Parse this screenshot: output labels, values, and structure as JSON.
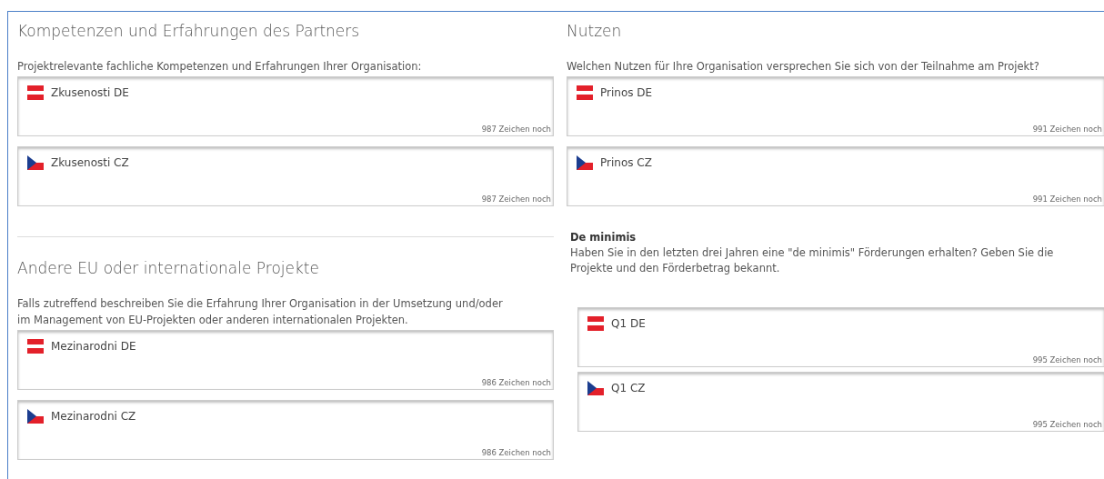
{
  "columns": [
    {
      "sections": [
        {
          "kind": "section",
          "title": "Kompetenzen und Erfahrungen des Partners",
          "label": "Projektrelevante fachliche Kompetenzen und Erfahrungen Ihrer Organisation:",
          "fields": [
            {
              "kind": "at",
              "value": "Zkusenosti DE",
              "counter": "987 Zeichen noch"
            },
            {
              "kind": "cz",
              "value": "Zkusenosti CZ",
              "counter": "987 Zeichen noch"
            }
          ]
        },
        {
          "kind": "section",
          "title": "Andere EU oder internationale Projekte",
          "label": "Falls zutreffend beschreiben Sie die Erfahrung Ihrer Organisation in der Umsetzung und/oder im Management von EU-Projekten oder anderen internationalen Projekten.",
          "fields": [
            {
              "kind": "at",
              "value": "Mezinarodni DE",
              "counter": "986 Zeichen noch"
            },
            {
              "kind": "cz",
              "value": "Mezinarodni CZ",
              "counter": "986 Zeichen noch"
            }
          ]
        }
      ]
    },
    {
      "sections": [
        {
          "kind": "section",
          "title": "Nutzen",
          "label": "Welchen Nutzen für Ihre Organisation versprechen Sie sich von der Teilnahme am Projekt?",
          "fields": [
            {
              "kind": "at",
              "value": "Prinos DE",
              "counter": "991 Zeichen noch"
            },
            {
              "kind": "cz",
              "value": "Prinos CZ",
              "counter": "991 Zeichen noch"
            }
          ]
        },
        {
          "kind": "question",
          "title": "De minimis",
          "label": "Haben Sie in den letzten drei Jahren eine \"de minimis\" Förderungen erhalten? Geben Sie die Projekte und den Förderbetrag bekannt.",
          "fields": [
            {
              "kind": "at",
              "value": "Q1 DE",
              "counter": "995 Zeichen noch"
            },
            {
              "kind": "cz",
              "value": "Q1 CZ",
              "counter": "995 Zeichen noch"
            }
          ]
        }
      ]
    }
  ]
}
